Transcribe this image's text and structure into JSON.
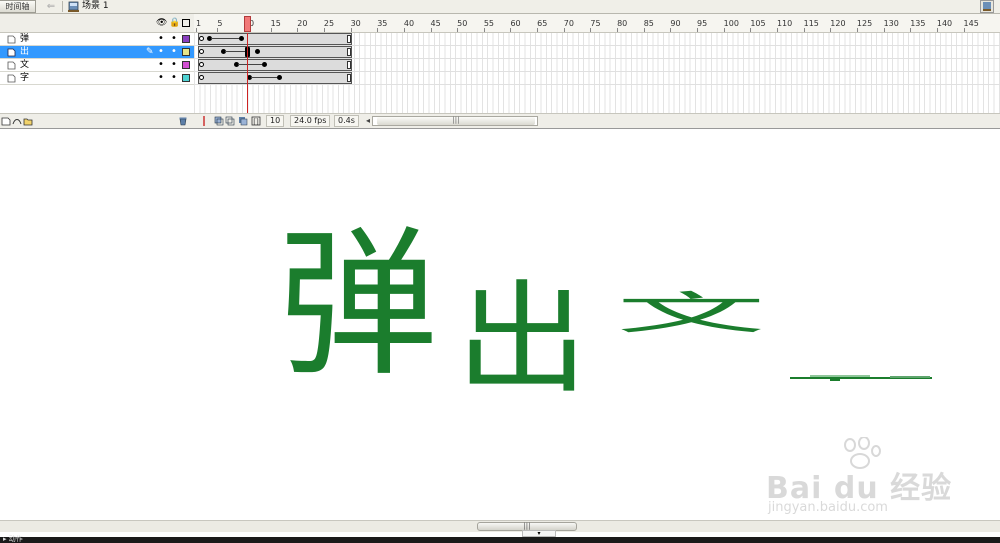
{
  "topbar": {
    "timeline_button": "时间轴",
    "scene_label": "场景 1"
  },
  "layers": [
    {
      "name": "弹",
      "color": "#8a3fc0",
      "selected": false
    },
    {
      "name": "出",
      "color": "#e6e68a",
      "selected": true
    },
    {
      "name": "文",
      "color": "#d34fd3",
      "selected": false
    },
    {
      "name": "字",
      "color": "#4fd3d3",
      "selected": false
    }
  ],
  "ruler": {
    "ticks": [
      "1",
      "5",
      "10",
      "15",
      "20",
      "25",
      "30",
      "35",
      "40",
      "45",
      "50",
      "55",
      "60",
      "65",
      "70",
      "75",
      "80",
      "85",
      "90",
      "95",
      "100",
      "105",
      "110",
      "115",
      "120",
      "125",
      "130",
      "135",
      "140",
      "145"
    ]
  },
  "playback": {
    "current_frame": "10",
    "frame_rate": "24.0 fps",
    "elapsed": "0.4s"
  },
  "stage": {
    "chars": [
      "弹",
      "出",
      "文"
    ],
    "text_color": "#1b7d2d"
  },
  "watermark": {
    "brand": "Bai du 经验",
    "url": "jingyan.baidu.com"
  },
  "action_bar": {
    "label": "▸ 动作"
  }
}
